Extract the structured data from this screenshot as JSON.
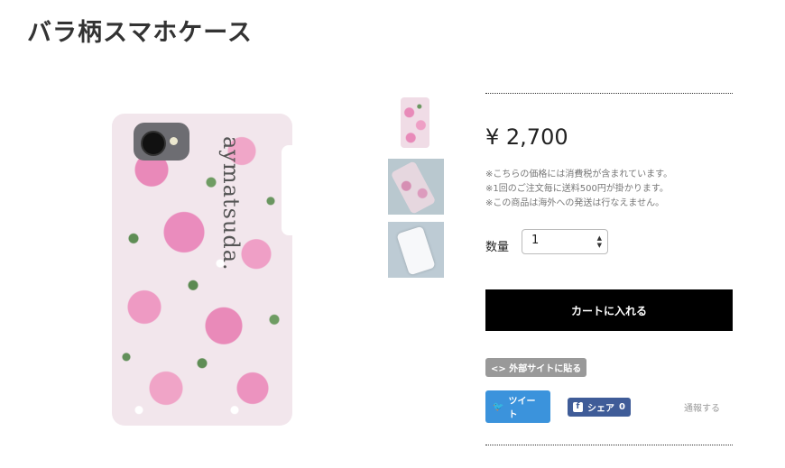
{
  "product": {
    "title": "バラ柄スマホケース",
    "brand_text": "aymatsuda.",
    "price": "¥ 2,700",
    "notes": [
      "※こちらの価格には消費税が含まれています。",
      "※1回のご注文毎に送料500円が掛かります。",
      "※この商品は海外への発送は行なえません。"
    ],
    "quantity_label": "数量",
    "quantity_value": "1",
    "cart_button": "カートに入れる",
    "embed_button": "外部サイトに貼る",
    "embed_icon": "<>",
    "tweet_button": "ツイート",
    "share_button": "シェア",
    "share_count": "0",
    "report_link": "通報する"
  },
  "icons": {
    "tweet": "twitter-bird-icon",
    "share": "facebook-f-icon",
    "embed": "code-icon",
    "select": "updown-chevron-icon"
  },
  "colors": {
    "cart_button": "#000000",
    "tweet": "#3b93dc",
    "share": "#3f5c98",
    "embed": "#999999",
    "rose": "#e98ab9"
  }
}
